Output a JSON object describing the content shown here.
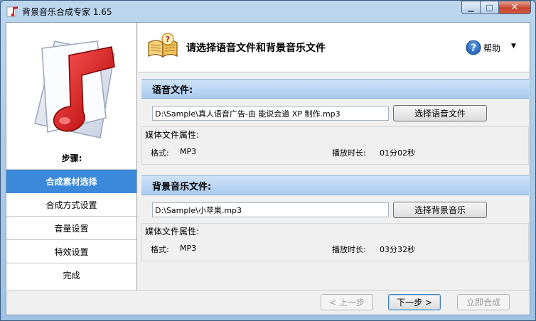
{
  "window": {
    "title": "背景音乐合成专家 1.65",
    "min_glyph": "▁",
    "max_glyph": "□",
    "close_glyph": "✕"
  },
  "sidebar": {
    "steps_label": "步骤:",
    "steps": [
      "合成素材选择",
      "合成方式设置",
      "音量设置",
      "特效设置",
      "完成"
    ],
    "active_index": 0
  },
  "header": {
    "title": "请选择语音文件和背景音乐文件",
    "help_label": "帮助",
    "help_caret": "▼"
  },
  "voice": {
    "section_title": "语音文件:",
    "path_value": "D:\\Sample\\真人语音广告-由 能说会道 XP 制作.mp3",
    "pick_button": "选择语音文件",
    "props_title": "媒体文件属性:",
    "format_label": "格式:",
    "format_value": "MP3",
    "duration_label": "播放时长:",
    "duration_value": "01分02秒"
  },
  "music": {
    "section_title": "背景音乐文件:",
    "path_value": "D:\\Sample\\小苹果.mp3",
    "pick_button": "选择背景音乐",
    "props_title": "媒体文件属性:",
    "format_label": "格式:",
    "format_value": "MP3",
    "duration_label": "播放时长:",
    "duration_value": "03分32秒"
  },
  "footer": {
    "prev": "< 上一步",
    "next": "下一步 >",
    "compose": "立即合成"
  },
  "colors": {
    "active_step": "#3c89dc",
    "section_header": "#a9cbef",
    "close_button": "#c6452e"
  }
}
